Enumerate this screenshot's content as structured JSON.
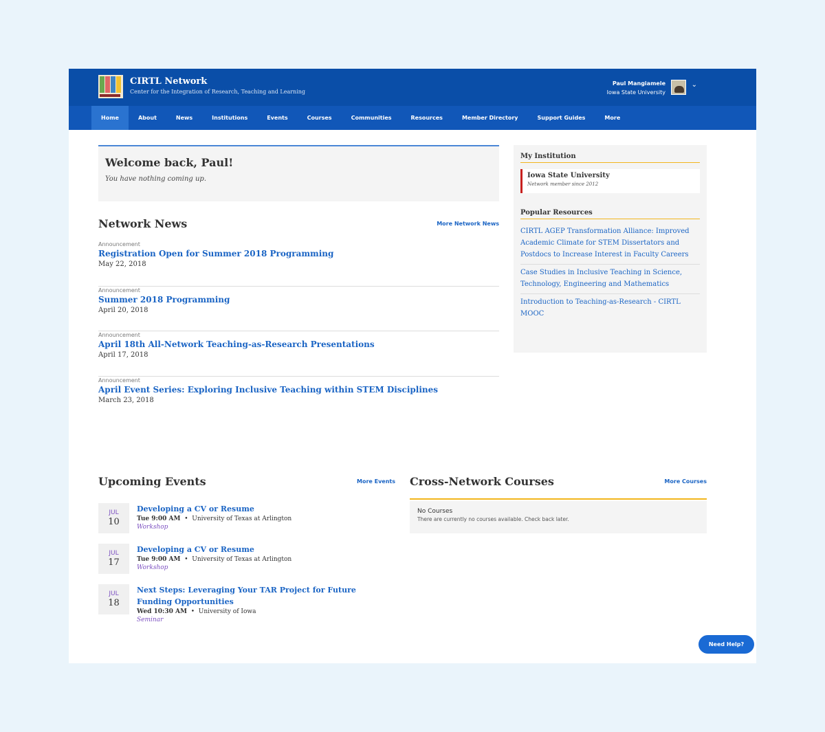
{
  "header": {
    "brand_title": "CIRTL Network",
    "brand_subtitle": "Center for the Integration of Research, Teaching and Learning",
    "logo_text": "CIRTL",
    "user_name": "Paul Mangiamele",
    "user_institution": "Iowa State University"
  },
  "nav": {
    "items": [
      "Home",
      "About",
      "News",
      "Institutions",
      "Events",
      "Courses",
      "Communities",
      "Resources",
      "Member Directory",
      "Support Guides",
      "More"
    ],
    "active": "Home"
  },
  "welcome": {
    "title": "Welcome back, Paul!",
    "subtitle": "You have nothing coming up."
  },
  "news": {
    "title": "Network News",
    "more_label": "More Network News",
    "items": [
      {
        "category": "Announcement",
        "title": "Registration Open for Summer 2018 Programming",
        "date": "May 22, 2018"
      },
      {
        "category": "Announcement",
        "title": "Summer 2018 Programming",
        "date": "April 20, 2018"
      },
      {
        "category": "Announcement",
        "title": "April 18th All-Network Teaching-as-Research Presentations",
        "date": "April 17, 2018"
      },
      {
        "category": "Announcement",
        "title": "April Event Series: Exploring Inclusive Teaching within STEM Disciplines",
        "date": "March 23, 2018"
      }
    ]
  },
  "sidebar": {
    "institution_title": "My Institution",
    "institution_name": "Iowa State University",
    "institution_since": "Network member since 2012",
    "resources_title": "Popular Resources",
    "resources": [
      "CIRTL AGEP Transformation Alliance: Improved Academic Climate for STEM Dissertators and Postdocs to Increase Interest in Faculty Careers",
      "Case Studies in Inclusive Teaching in Science, Technology, Engineering and Mathematics",
      "Introduction to Teaching-as-Research - CIRTL MOOC"
    ]
  },
  "events": {
    "title": "Upcoming Events",
    "more_label": "More Events",
    "items": [
      {
        "month": "JUL",
        "day": "10",
        "title": "Developing a CV or Resume",
        "time": "Tue 9:00 AM",
        "location": "University of Texas at Arlington",
        "type": "Workshop"
      },
      {
        "month": "JUL",
        "day": "17",
        "title": "Developing a CV or Resume",
        "time": "Tue 9:00 AM",
        "location": "University of Texas at Arlington",
        "type": "Workshop"
      },
      {
        "month": "JUL",
        "day": "18",
        "title": "Next Steps: Leveraging Your TAR Project for Future Funding Opportunities",
        "time": "Wed 10:30 AM",
        "location": "University of Iowa",
        "type": "Seminar"
      }
    ]
  },
  "courses": {
    "title": "Cross-Network Courses",
    "more_label": "More Courses",
    "empty_title": "No Courses",
    "empty_desc": "There are currently no courses available. Check back later."
  },
  "help": {
    "label": "Need Help?"
  },
  "colors": {
    "header_bg": "#0a4ea8",
    "nav_bg": "#1157b8",
    "link": "#1a64c4",
    "accent_yellow": "#f2b51b",
    "accent_red": "#c8211f",
    "event_purple": "#7b4fc0"
  }
}
